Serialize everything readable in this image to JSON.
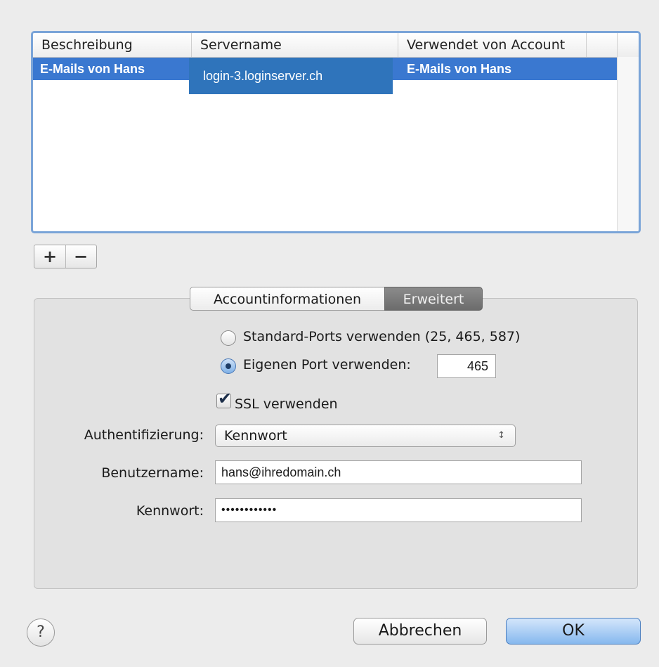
{
  "table": {
    "columns": [
      "Beschreibung",
      "Servername",
      "Verwendet von Account"
    ],
    "row": {
      "description": "E-Mails von Hans",
      "server": "login-3.loginserver.ch",
      "account": "E-Mails von Hans"
    }
  },
  "list_buttons": {
    "add": "+",
    "remove": "−"
  },
  "tabs": [
    {
      "label": "Accountinformationen",
      "selected": false
    },
    {
      "label": "Erweitert",
      "selected": true
    }
  ],
  "advanced": {
    "standard_ports_label": "Standard-Ports verwenden (25, 465, 587)",
    "custom_port_label": "Eigenen Port verwenden:",
    "port_value": "465",
    "ssl_label": "SSL verwenden",
    "auth_label": "Authentifizierung:",
    "auth_value": "Kennwort",
    "username_label": "Benutzername:",
    "username_value": "hans@ihredomain.ch",
    "password_label": "Kennwort:",
    "password_value": "••••••••••••"
  },
  "footer": {
    "help": "?",
    "cancel": "Abbrechen",
    "ok": "OK"
  },
  "colors": {
    "selection": "#3a78d0",
    "server_overlay": "#2f74bb",
    "focus_ring": "#7aa4d8"
  }
}
